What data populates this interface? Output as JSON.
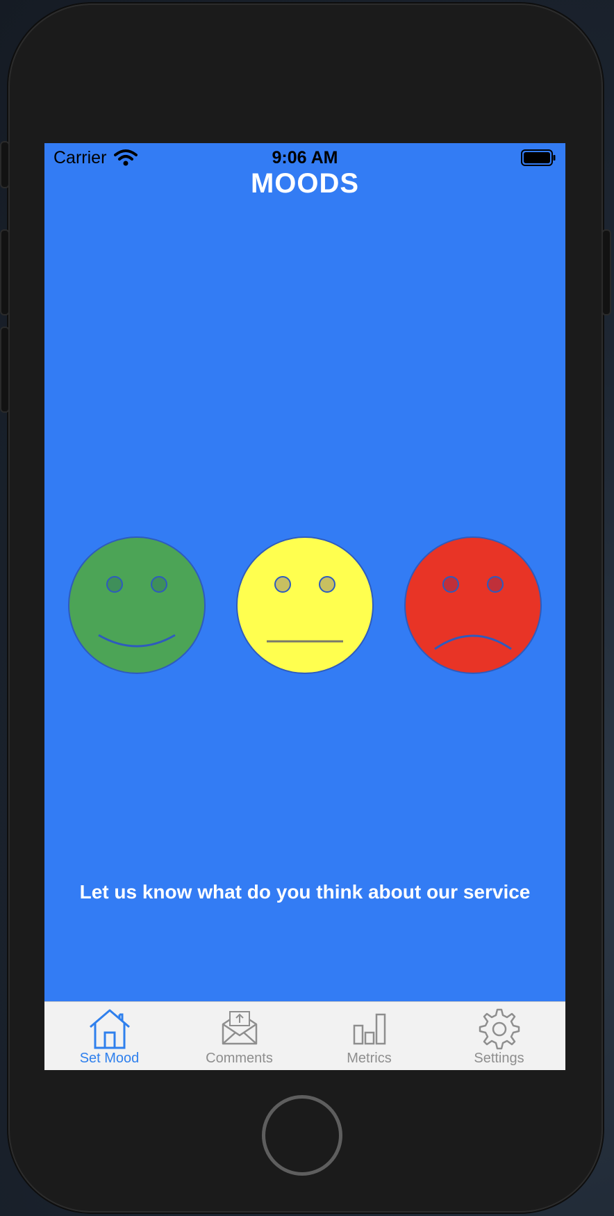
{
  "status_bar": {
    "carrier": "Carrier",
    "time": "9:06 AM"
  },
  "header": {
    "title": "MOODS"
  },
  "moods": [
    {
      "name": "happy",
      "color": "#4ca456"
    },
    {
      "name": "neutral",
      "color": "#ffff4f"
    },
    {
      "name": "sad",
      "color": "#e83426"
    }
  ],
  "tagline": "Let us know what do you think about our service",
  "tab_bar": {
    "items": [
      {
        "label": "Set Mood",
        "icon": "house-icon",
        "active": true
      },
      {
        "label": "Comments",
        "icon": "envelope-icon",
        "active": false
      },
      {
        "label": "Metrics",
        "icon": "bar-chart-icon",
        "active": false
      },
      {
        "label": "Settings",
        "icon": "gear-icon",
        "active": false
      }
    ]
  },
  "colors": {
    "background": "#337cf4",
    "tab_active": "#2f80ed",
    "tab_inactive": "#8e8e8e"
  }
}
